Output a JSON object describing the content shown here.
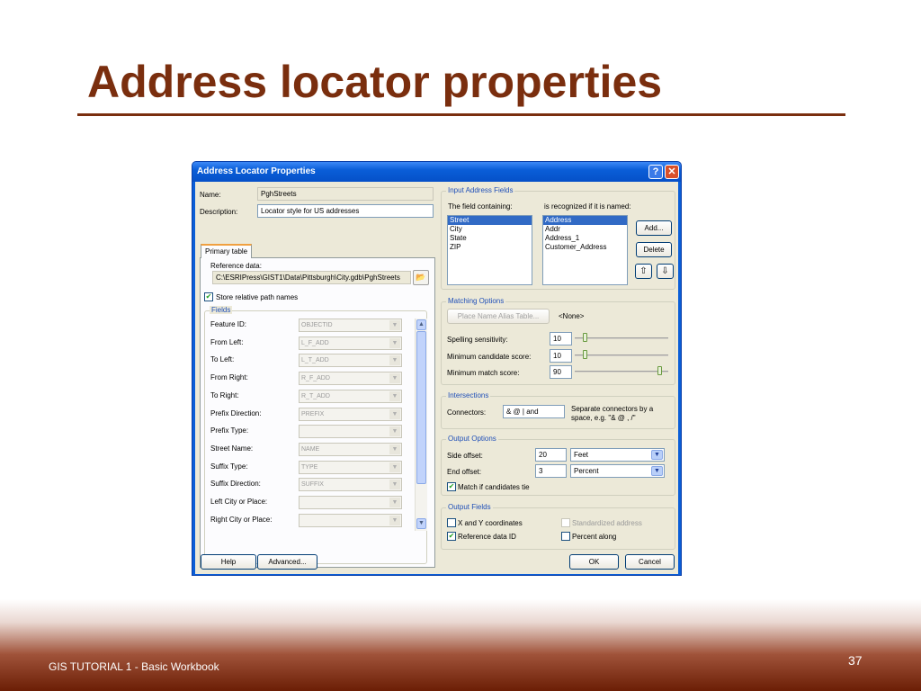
{
  "slide": {
    "title": "Address locator properties",
    "footer": "GIS TUTORIAL 1 - Basic Workbook",
    "page_number": "37"
  },
  "dialog": {
    "title": "Address Locator Properties",
    "help_glyph": "?",
    "close_glyph": "✕",
    "name_label": "Name:",
    "name_value": "PghStreets",
    "description_label": "Description:",
    "description_value": "Locator style for US addresses",
    "tab_primary": "Primary table",
    "reference_data_label": "Reference data:",
    "reference_data_value": "C:\\ESRIPress\\GIST1\\Data\\Pittsburgh\\City.gdb\\PghStreets",
    "store_relative_label": "Store relative path names",
    "store_relative_checked": true,
    "fields_title": "Fields",
    "fields": [
      {
        "label": "Feature ID:",
        "value": "OBJECTID"
      },
      {
        "label": "From Left:",
        "value": "L_F_ADD"
      },
      {
        "label": "To Left:",
        "value": "L_T_ADD"
      },
      {
        "label": "From Right:",
        "value": "R_F_ADD"
      },
      {
        "label": "To Right:",
        "value": "R_T_ADD"
      },
      {
        "label": "Prefix Direction:",
        "value": "PREFIX"
      },
      {
        "label": "Prefix Type:",
        "value": ""
      },
      {
        "label": "Street Name:",
        "value": "NAME"
      },
      {
        "label": "Suffix Type:",
        "value": "TYPE"
      },
      {
        "label": "Suffix Direction:",
        "value": "SUFFIX"
      },
      {
        "label": "Left City or Place:",
        "value": ""
      },
      {
        "label": "Right City or Place:",
        "value": ""
      }
    ],
    "input_fields": {
      "title": "Input Address Fields",
      "col1_header": "The field containing:",
      "col2_header": "is recognized if it is named:",
      "field_types": [
        "Street",
        "City",
        "State",
        "ZIP"
      ],
      "aliases": [
        "Address",
        "Addr",
        "Address_1",
        "Customer_Address"
      ],
      "add_label": "Add...",
      "delete_label": "Delete",
      "up_glyph": "⇧",
      "down_glyph": "⇩"
    },
    "matching": {
      "title": "Matching Options",
      "alias_button": "Place Name Alias Table...",
      "alias_value": "<None>",
      "spelling_label": "Spelling sensitivity:",
      "spelling_value": "10",
      "candidate_label": "Minimum candidate score:",
      "candidate_value": "10",
      "match_label": "Minimum match score:",
      "match_value": "90"
    },
    "intersections": {
      "title": "Intersections",
      "connectors_label": "Connectors:",
      "connectors_value": "& @ | and",
      "hint": "Separate connectors by a space, e.g. \"& @ , /\""
    },
    "output_options": {
      "title": "Output Options",
      "side_offset_label": "Side offset:",
      "side_offset_value": "20",
      "side_offset_unit": "Feet",
      "end_offset_label": "End offset:",
      "end_offset_value": "3",
      "end_offset_unit": "Percent",
      "match_tie_label": "Match if candidates tie",
      "match_tie_checked": true
    },
    "output_fields": {
      "title": "Output Fields",
      "xy_label": "X and Y coordinates",
      "xy_checked": false,
      "standardized_label": "Standardized address",
      "standardized_checked": false,
      "refid_label": "Reference data ID",
      "refid_checked": true,
      "percent_label": "Percent along",
      "percent_checked": false
    },
    "buttons": {
      "help": "Help",
      "advanced": "Advanced...",
      "ok": "OK",
      "cancel": "Cancel"
    }
  }
}
